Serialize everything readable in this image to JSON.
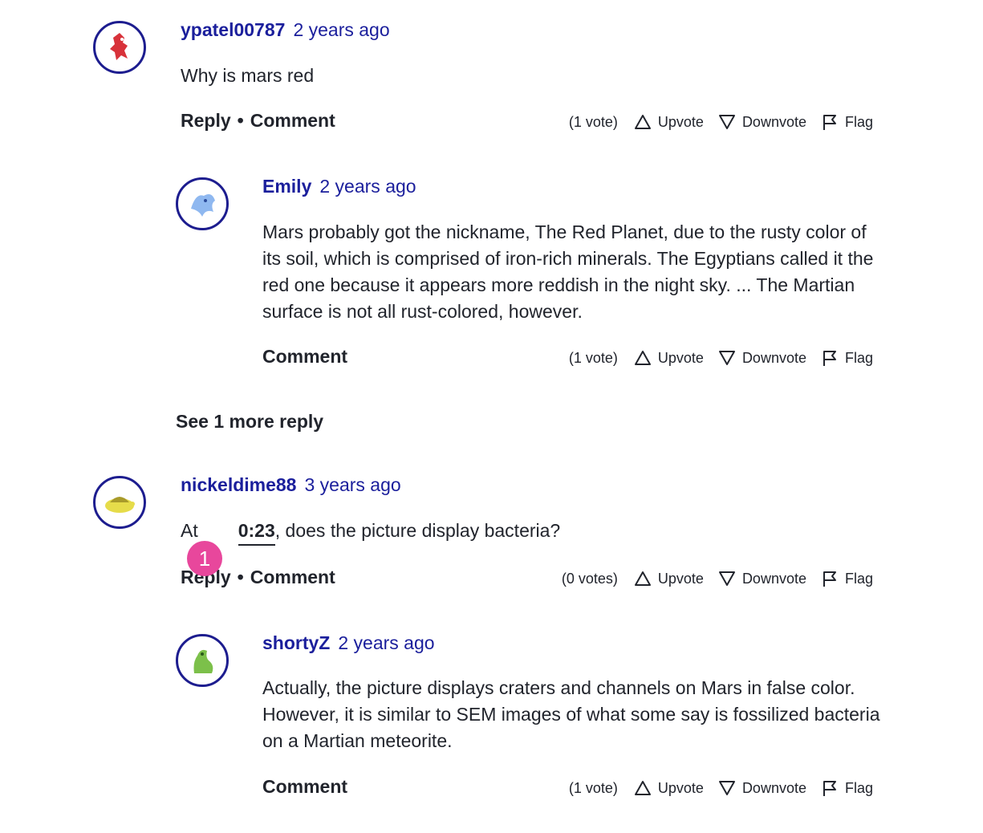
{
  "comments": [
    {
      "author": "ypatel00787",
      "time": "2 years ago",
      "text": "Why is mars red",
      "reply_label": "Reply",
      "bullet": "•",
      "comment_label": "Comment",
      "votes": "(1 vote)",
      "upvote": "Upvote",
      "downvote": "Downvote",
      "flag": "Flag",
      "avatar_icon": "red-creature-avatar-icon"
    },
    {
      "author": "Emily",
      "time": "2 years ago",
      "text": "Mars probably got the nickname, The Red Planet, due to the rusty color of its soil, which is comprised of iron-rich minerals. The Egyptians called it the red one because it appears more reddish in the night sky. ... The Martian surface is not all rust-colored, however.",
      "comment_label": "Comment",
      "votes": "(1 vote)",
      "upvote": "Upvote",
      "downvote": "Downvote",
      "flag": "Flag",
      "avatar_icon": "blue-creature-avatar-icon"
    },
    {
      "author": "nickeldime88",
      "time": "3 years ago",
      "text_prefix": "At",
      "timestamp": "0:23",
      "text_suffix": ", does the picture display bacteria?",
      "reply_label": "Reply",
      "bullet": "•",
      "comment_label": "Comment",
      "votes": "(0 votes)",
      "upvote": "Upvote",
      "downvote": "Downvote",
      "flag": "Flag",
      "avatar_icon": "yellow-turtle-avatar-icon"
    },
    {
      "author": "shortyZ",
      "time": "2 years ago",
      "text": "Actually, the picture displays craters and channels on Mars in false color. However, it is similar to SEM images of what some say is fossilized bacteria on a Martian meteorite.",
      "comment_label": "Comment",
      "votes": "(1 vote)",
      "upvote": "Upvote",
      "downvote": "Downvote",
      "flag": "Flag",
      "avatar_icon": "green-creature-avatar-icon"
    }
  ],
  "see_more": "See 1 more reply",
  "badge": "1",
  "colors": {
    "author": "#1b1f9c",
    "avatar_border": "#1d1d8f",
    "badge": "#e8479c",
    "text": "#21242c"
  }
}
